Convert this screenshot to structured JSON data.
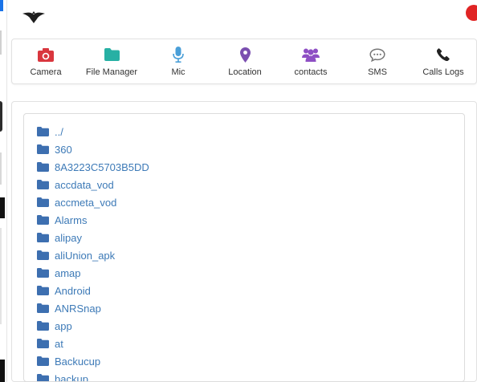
{
  "colors": {
    "accent": "#3d7ab7",
    "camera": "#d9363e",
    "file_manager": "#27b0a4",
    "mic": "#4a9fd8",
    "location": "#7b4fb0",
    "contacts": "#8e4fc4",
    "sms": "#777777",
    "calls": "#222222",
    "folder": "#3d6fb0",
    "status_dot": "#e02424"
  },
  "header": {
    "logo_icon": "bird-logo-icon",
    "status_icon": "red-dot-icon"
  },
  "nav": {
    "items": [
      {
        "label": "Camera",
        "icon": "camera-icon"
      },
      {
        "label": "File Manager",
        "icon": "folder-icon"
      },
      {
        "label": "Mic",
        "icon": "microphone-icon"
      },
      {
        "label": "Location",
        "icon": "map-pin-icon"
      },
      {
        "label": "contacts",
        "icon": "users-icon"
      },
      {
        "label": "SMS",
        "icon": "chat-icon"
      },
      {
        "label": "Calls Logs",
        "icon": "phone-icon"
      }
    ]
  },
  "file_manager": {
    "entries": [
      {
        "name": "../",
        "icon": "folder-icon"
      },
      {
        "name": "360",
        "icon": "folder-icon"
      },
      {
        "name": "8A3223C5703B5DD",
        "icon": "folder-icon"
      },
      {
        "name": "accdata_vod",
        "icon": "folder-icon"
      },
      {
        "name": "accmeta_vod",
        "icon": "folder-icon"
      },
      {
        "name": "Alarms",
        "icon": "folder-icon"
      },
      {
        "name": "alipay",
        "icon": "folder-icon"
      },
      {
        "name": "aliUnion_apk",
        "icon": "folder-icon"
      },
      {
        "name": "amap",
        "icon": "folder-icon"
      },
      {
        "name": "Android",
        "icon": "folder-icon"
      },
      {
        "name": "ANRSnap",
        "icon": "folder-icon"
      },
      {
        "name": "app",
        "icon": "folder-icon"
      },
      {
        "name": "at",
        "icon": "folder-icon"
      },
      {
        "name": "Backucup",
        "icon": "folder-icon"
      },
      {
        "name": "backup",
        "icon": "folder-icon"
      }
    ]
  }
}
